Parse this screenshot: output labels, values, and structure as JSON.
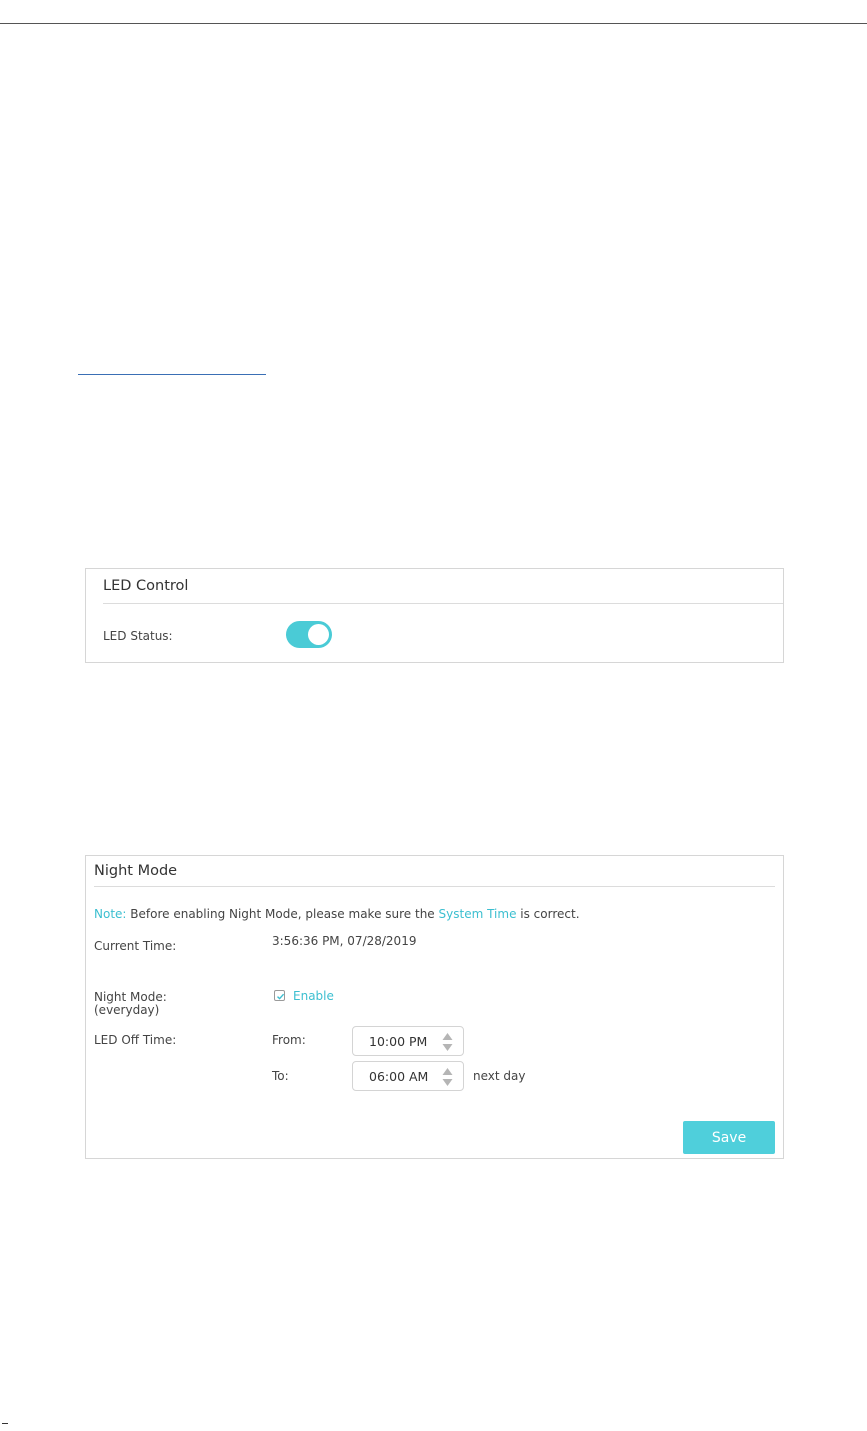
{
  "led_control": {
    "title": "LED Control",
    "status_label": "LED Status:",
    "status_on": true
  },
  "night_mode": {
    "title": "Night Mode",
    "note_key": "Note:",
    "note_before": "Before enabling Night Mode, please make sure the",
    "note_link": "System Time",
    "note_after": "is correct.",
    "current_time_label": "Current Time:",
    "current_time_value": "3:56:36 PM, 07/28/2019",
    "mode_label_line1": "Night Mode:",
    "mode_label_line2": "(everyday)",
    "enable_label": "Enable",
    "enable_checked": true,
    "off_time_label": "LED Off Time:",
    "from_label": "From:",
    "from_value": "10:00 PM",
    "to_label": "To:",
    "to_value": "06:00 AM",
    "next_day_label": "next day",
    "save_label": "Save"
  },
  "colors": {
    "accent": "#4acbd6",
    "link": "#3cbfd0"
  }
}
